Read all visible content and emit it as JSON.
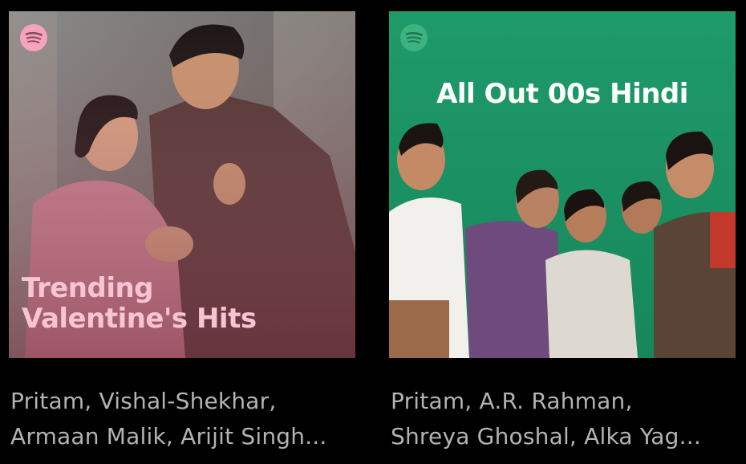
{
  "playlists": [
    {
      "cover_title_lines": [
        "Trending",
        "Valentine's Hits"
      ],
      "description_lines": [
        "Pritam, Vishal-Shekhar,",
        "Armaan Malik, Arijit Singh..."
      ],
      "accent": "#f7c4d4",
      "logo_color": "#f5a3be"
    },
    {
      "cover_title_lines": [
        "All Out 00s Hindi"
      ],
      "description_lines": [
        "Pritam, A.R. Rahman,",
        "Shreya Ghoshal, Alka Yag..."
      ],
      "accent": "#ffffff",
      "logo_color": "#3fb37f",
      "background": "#1f9a6a"
    }
  ]
}
